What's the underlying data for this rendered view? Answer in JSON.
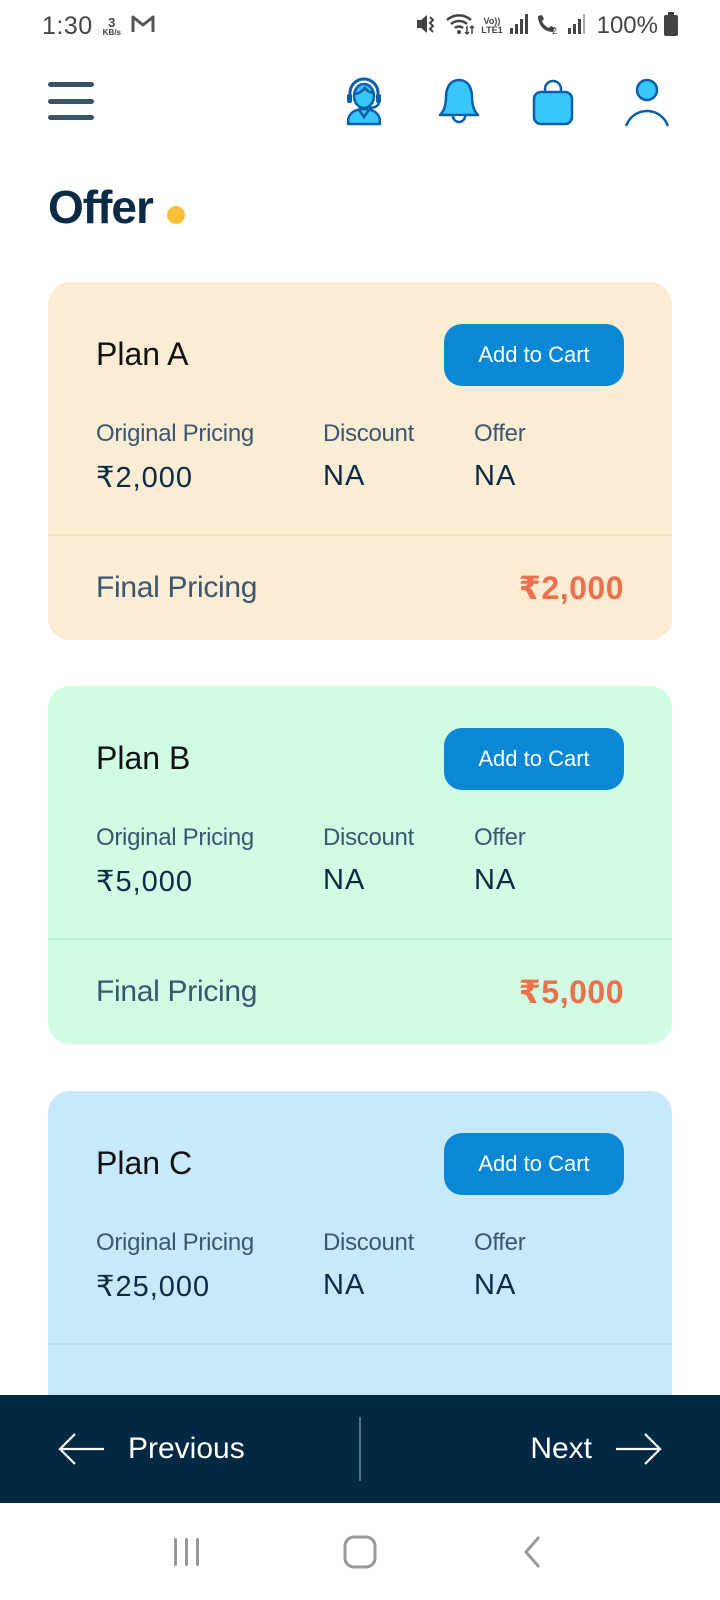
{
  "status_bar": {
    "time": "1:30",
    "net_speed_value": "3",
    "net_speed_unit": "KB/s",
    "lte_top": "Vo))",
    "lte_bottom": "LTE1",
    "battery": "100%"
  },
  "header": {
    "icons": [
      "menu-icon",
      "customer-support-icon",
      "bell-icon",
      "shopping-bag-icon",
      "user-icon"
    ]
  },
  "page": {
    "title": "Offer"
  },
  "labels": {
    "original_pricing": "Original Pricing",
    "discount": "Discount",
    "offer": "Offer",
    "final_pricing": "Final Pricing",
    "add_to_cart": "Add to Cart"
  },
  "plans": [
    {
      "name": "Plan A",
      "original_pricing": "₹2,000",
      "discount": "NA",
      "offer": "NA",
      "final_pricing": "₹2,000",
      "bg_color": "#fbecd4",
      "divider_color": "#f1dfc4"
    },
    {
      "name": "Plan B",
      "original_pricing": "₹5,000",
      "discount": "NA",
      "offer": "NA",
      "final_pricing": "₹5,000",
      "bg_color": "#cffce2",
      "divider_color": "#bfeed6"
    },
    {
      "name": "Plan C",
      "original_pricing": "₹25,000",
      "discount": "NA",
      "offer": "NA",
      "final_pricing": "",
      "bg_color": "#c8e9fc",
      "divider_color": "#b7dcf2"
    }
  ],
  "pager": {
    "previous": "Previous",
    "next": "Next"
  },
  "colors": {
    "accent_button": "#0a88d6",
    "final_price": "#ee6f4c",
    "pager_bg": "#022944",
    "title_dot": "#fbbf3a",
    "icon_fill": "#38c6fb",
    "icon_stroke": "#0a5fa8"
  }
}
